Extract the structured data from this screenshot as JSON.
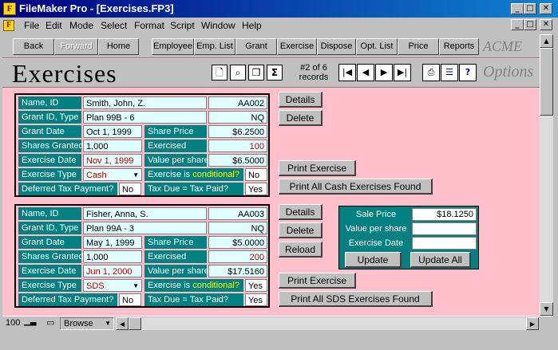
{
  "window": {
    "title": "FileMaker Pro - [Exercises.FP3]",
    "controls": [
      "_",
      "□",
      "✕"
    ]
  },
  "menubar": {
    "items": [
      "File",
      "Edit",
      "Mode",
      "Select",
      "Format",
      "Script",
      "Window",
      "Help"
    ],
    "mdi_controls": [
      "_",
      "□",
      "✕"
    ]
  },
  "nav": {
    "buttons": [
      "Back",
      "Forward",
      "Home",
      "Employee",
      "Emp. List",
      "Grant",
      "Exercise",
      "Dispose",
      "Opt. List",
      "Price",
      "Reports"
    ],
    "brand": "ACME"
  },
  "header": {
    "page_title": "Exercises",
    "record_info_line1": "#2 of 6",
    "record_info_line2": "records",
    "options": "Options",
    "toolbar_icons": [
      "new-document-icon",
      "find-icon",
      "copy-icon",
      "sigma-icon"
    ],
    "nav_icons": [
      "first-record-icon",
      "previous-record-icon",
      "next-record-icon",
      "last-record-icon"
    ],
    "tool_icons": [
      "print-icon",
      "script-icon",
      "help-icon"
    ]
  },
  "labels": {
    "name_id": "Name, ID",
    "grant_id_type": "Grant ID, Type",
    "grant_date": "Grant Date",
    "share_price": "Share Price",
    "shares_granted": "Shares Granted",
    "exercised": "Exercised",
    "exercise_date": "Exercise Date",
    "value_per_share": "Value per share",
    "exercise_type": "Exercise Type",
    "exercise_is": "Exercise is ",
    "conditional": "conditional?",
    "deferred": "Deferred Tax Payment?",
    "tax_due": "Tax Due = Tax Paid?"
  },
  "records": [
    {
      "name": "Smith, John, Z.",
      "id": "AA002",
      "grant_id": "Plan 99B - 6",
      "grant_type": "NQ",
      "grant_date": "Oct 1, 1999",
      "share_price": "$6.2500",
      "shares_granted": "1,000",
      "exercised": "100",
      "exercise_date": "Nov 1, 1999",
      "value_per_share": "$6.5000",
      "exercise_type": "Cash",
      "conditional": "No",
      "deferred": "No",
      "tax_due_equal": "Yes",
      "buttons": {
        "details": "Details",
        "delete": "Delete",
        "print": "Print Exercise",
        "print_all": "Print All Cash Exercises Found"
      }
    },
    {
      "name": "Fisher, Anna, S.",
      "id": "AA003",
      "grant_id": "Plan 99A - 3",
      "grant_type": "NQ",
      "grant_date": "May 1, 1999",
      "share_price": "$5.0000",
      "shares_granted": "1,000",
      "exercised": "200",
      "exercise_date": "Jun 1, 2000",
      "value_per_share": "$17.5160",
      "exercise_type": "SDS",
      "conditional": "Yes",
      "deferred": "No",
      "tax_due_equal": "Yes",
      "buttons": {
        "details": "Details",
        "delete": "Delete",
        "reload": "Reload",
        "print": "Print Exercise",
        "print_all": "Print All SDS Exercises Found"
      }
    }
  ],
  "price_box": {
    "sale_price_label": "Sale Price",
    "sale_price": "$18.1250",
    "value_per_share_label": "Value per share",
    "value_per_share": "",
    "exercise_date_label": "Exercise Date",
    "exercise_date": "",
    "update": "Update",
    "update_all": "Update All"
  },
  "status": {
    "zoom": "100",
    "mode": "Browse"
  },
  "colors": {
    "background": "#ffc0cb",
    "label": "#008080",
    "field": "#e0ffff",
    "title_bar": "#000080"
  }
}
